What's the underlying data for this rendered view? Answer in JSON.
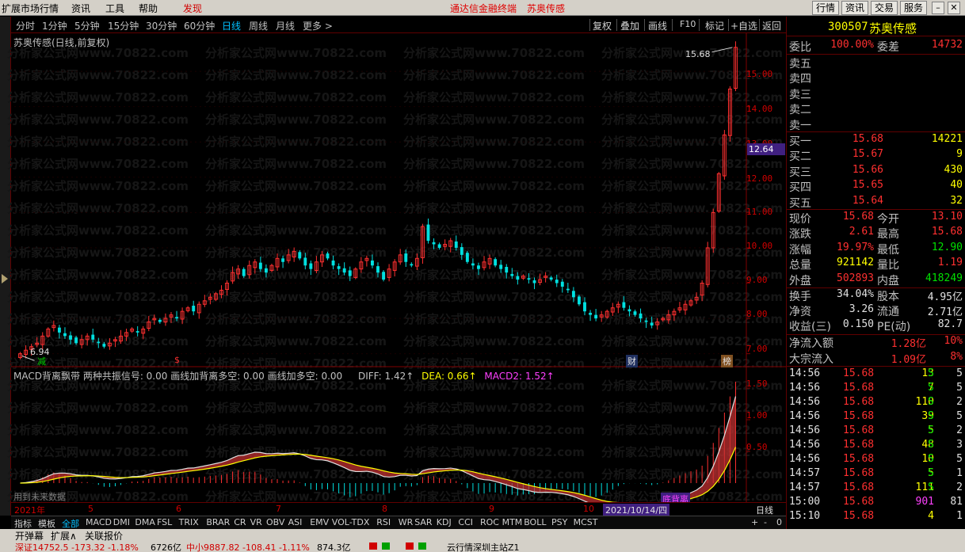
{
  "menubar": {
    "items": [
      "扩展市场行情",
      "资讯",
      "工具",
      "帮助",
      "发现"
    ],
    "promo1": "通达信金融终端",
    "promo2": "苏奥传感",
    "right_buttons": [
      "行情",
      "资讯",
      "交易",
      "服务"
    ]
  },
  "periods": [
    "分时",
    "1分钟",
    "5分钟",
    "15分钟",
    "30分钟",
    "60分钟",
    "日线",
    "周线",
    "月线",
    "更多 >"
  ],
  "active_period": "日线",
  "toolbar": [
    "复权",
    "叠加",
    "画线",
    "F10",
    "标记",
    "+自选",
    "返回"
  ],
  "chart": {
    "title": "苏奥传感(日线,前复权)",
    "macd_label": "MACD背离飘带",
    "macd_signals": "两种共振信号: 0.00  画线加背离多空: 0.00  画线加多空: 0.00",
    "diff": "DIFF: 1.42↑",
    "dea": "DEA: 0.66↑",
    "macd2": "MACD2: 1.52↑",
    "future_data_note": "用到未来数据",
    "high_label": "15.68",
    "low_label": "6.94",
    "current_price_badge": "12.64",
    "date_highlight": "2021/10/14/四",
    "period_label_bottom": "日线",
    "events": [
      "减",
      "$",
      "财",
      "榜"
    ],
    "macd_event": "底背离",
    "watermark": "分析家公式网www.70822.com",
    "price_axis": [
      "15.00",
      "14.00",
      "13.00",
      "12.00",
      "11.00",
      "10.00",
      "9.00",
      "8.00",
      "7.00"
    ],
    "macd_axis": [
      "1.50",
      "1.00",
      "0.50"
    ]
  },
  "chart_data": {
    "type": "candlestick",
    "title": "苏奥传感(日线,前复权)",
    "ylim": [
      6.7,
      15.9
    ],
    "high": 15.68,
    "low": 6.94,
    "closes": [
      7.0,
      7.1,
      7.2,
      7.3,
      7.5,
      7.7,
      7.8,
      7.6,
      7.5,
      7.4,
      7.3,
      7.4,
      7.5,
      7.4,
      7.3,
      7.2,
      7.3,
      7.4,
      7.5,
      7.6,
      7.7,
      7.6,
      7.7,
      7.9,
      8.0,
      7.9,
      8.0,
      8.1,
      8.0,
      8.2,
      8.3,
      8.2,
      8.4,
      8.5,
      8.6,
      8.7,
      8.8,
      9.0,
      9.3,
      9.4,
      9.2,
      9.5,
      9.6,
      9.4,
      9.3,
      9.5,
      9.7,
      9.6,
      9.8,
      9.9,
      9.7,
      9.5,
      9.4,
      9.6,
      9.8,
      9.7,
      9.5,
      9.4,
      9.3,
      9.2,
      9.4,
      9.6,
      9.7,
      9.5,
      9.3,
      9.1,
      9.4,
      9.6,
      9.8,
      9.6,
      9.5,
      9.7,
      10.6,
      10.2,
      10.1,
      10.0,
      10.1,
      10.2,
      10.0,
      9.8,
      9.6,
      9.5,
      9.4,
      9.6,
      9.7,
      9.5,
      9.4,
      9.3,
      9.2,
      9.1,
      9.2,
      9.1,
      9.0,
      9.1,
      9.2,
      9.1,
      9.0,
      8.9,
      8.8,
      8.6,
      8.4,
      8.2,
      8.1,
      8.0,
      8.1,
      8.2,
      8.3,
      8.4,
      8.3,
      8.2,
      8.1,
      8.0,
      7.9,
      7.8,
      7.9,
      8.0,
      8.1,
      8.2,
      8.3,
      8.4,
      8.5,
      8.6,
      9.0,
      10.0,
      11.0,
      12.1,
      13.2,
      14.5,
      15.68
    ],
    "macd_axis_range": [
      -0.3,
      1.6
    ]
  },
  "quote": {
    "code": "300507",
    "name": "苏奥传感",
    "weibi_label": "委比",
    "weibi": "100.00%",
    "weicha_label": "委差",
    "weicha": "14732",
    "asks": [
      {
        "label": "卖五",
        "price": "",
        "vol": ""
      },
      {
        "label": "卖四",
        "price": "",
        "vol": ""
      },
      {
        "label": "卖三",
        "price": "",
        "vol": ""
      },
      {
        "label": "卖二",
        "price": "",
        "vol": ""
      },
      {
        "label": "卖一",
        "price": "",
        "vol": ""
      }
    ],
    "bids": [
      {
        "label": "买一",
        "price": "15.68",
        "vol": "14221"
      },
      {
        "label": "买二",
        "price": "15.67",
        "vol": "9"
      },
      {
        "label": "买三",
        "price": "15.66",
        "vol": "430"
      },
      {
        "label": "买四",
        "price": "15.65",
        "vol": "40"
      },
      {
        "label": "买五",
        "price": "15.64",
        "vol": "32"
      }
    ],
    "stats": [
      {
        "l1": "现价",
        "v1": "15.68",
        "c1": "red",
        "l2": "今开",
        "v2": "13.10",
        "c2": "red"
      },
      {
        "l1": "涨跌",
        "v1": "2.61",
        "c1": "red",
        "l2": "最高",
        "v2": "15.68",
        "c2": "red"
      },
      {
        "l1": "涨幅",
        "v1": "19.97%",
        "c1": "red",
        "l2": "最低",
        "v2": "12.90",
        "c2": "green"
      },
      {
        "l1": "总量",
        "v1": "921142",
        "c1": "yellow",
        "l2": "量比",
        "v2": "1.19",
        "c2": "red"
      },
      {
        "l1": "外盘",
        "v1": "502893",
        "c1": "red",
        "l2": "内盘",
        "v2": "418249",
        "c2": "green"
      }
    ],
    "stats2": [
      {
        "l1": "换手",
        "v1": "34.04%",
        "c1": "white",
        "l2": "股本",
        "v2": "4.95亿",
        "c2": "white"
      },
      {
        "l1": "净资",
        "v1": "3.26",
        "c1": "white",
        "l2": "流通",
        "v2": "2.71亿",
        "c2": "white"
      },
      {
        "l1": "收益(三)",
        "v1": "0.150",
        "c1": "white",
        "l2": "PE(动)",
        "v2": "82.7",
        "c2": "white"
      }
    ],
    "flow": [
      {
        "label": "净流入额",
        "value": "1.28亿",
        "pct": "10%"
      },
      {
        "label": "大宗流入",
        "value": "1.09亿",
        "pct": "8%"
      }
    ],
    "ticks": [
      {
        "t": "14:56",
        "p": "15.68",
        "v": "13",
        "vc": "yellow",
        "s": "S",
        "n": "5"
      },
      {
        "t": "14:56",
        "p": "15.68",
        "v": "7",
        "vc": "yellow",
        "s": "S",
        "n": "5"
      },
      {
        "t": "14:56",
        "p": "15.68",
        "v": "110",
        "vc": "yellow",
        "s": "S",
        "n": "2"
      },
      {
        "t": "14:56",
        "p": "15.68",
        "v": "39",
        "vc": "yellow",
        "s": "S",
        "n": "5"
      },
      {
        "t": "14:56",
        "p": "15.68",
        "v": "5",
        "vc": "yellow",
        "s": "S",
        "n": "2"
      },
      {
        "t": "14:56",
        "p": "15.68",
        "v": "48",
        "vc": "yellow",
        "s": "S",
        "n": "3"
      },
      {
        "t": "14:56",
        "p": "15.68",
        "v": "10",
        "vc": "yellow",
        "s": "S",
        "n": "5"
      },
      {
        "t": "14:57",
        "p": "15.68",
        "v": "5",
        "vc": "yellow",
        "s": "S",
        "n": "1"
      },
      {
        "t": "14:57",
        "p": "15.68",
        "v": "111",
        "vc": "yellow",
        "s": "S",
        "n": "2"
      },
      {
        "t": "15:00",
        "p": "15.68",
        "v": "901",
        "vc": "magenta",
        "s": "",
        "n": "81"
      },
      {
        "t": "15:10",
        "p": "15.68",
        "v": "4",
        "vc": "yellow",
        "s": "",
        "n": "1"
      }
    ],
    "right_tabs": [
      "笔",
      "价",
      "细",
      "势",
      "联",
      "值",
      "主",
      "筹"
    ]
  },
  "dates": [
    "2021年",
    "5",
    "6",
    "7",
    "8",
    "9",
    "10"
  ],
  "indicator_tabs": [
    "指标",
    "模板",
    "全部",
    "MACD",
    "DMI",
    "DMA",
    "FSL",
    "TRIX",
    "BRAR",
    "CR",
    "VR",
    "OBV",
    "ASI",
    "EMV",
    "VOL-TDX",
    "RSI",
    "WR",
    "SAR",
    "KDJ",
    "CCI",
    "ROC",
    "MTM",
    "BOLL",
    "PSY",
    "MCST"
  ],
  "indicator_right": [
    "+",
    "-",
    "0"
  ],
  "bottom_tabs": [
    "开弹幕",
    "扩展∧",
    "关联报价"
  ],
  "status": {
    "sz": "深证14752.5 -173.32 -1.18%",
    "sz_amt": "6726亿",
    "zx": "中小9887.82 -108.41 -1.11%",
    "zx_amt": "874.3亿",
    "server": "云行情深圳主站Z1"
  }
}
